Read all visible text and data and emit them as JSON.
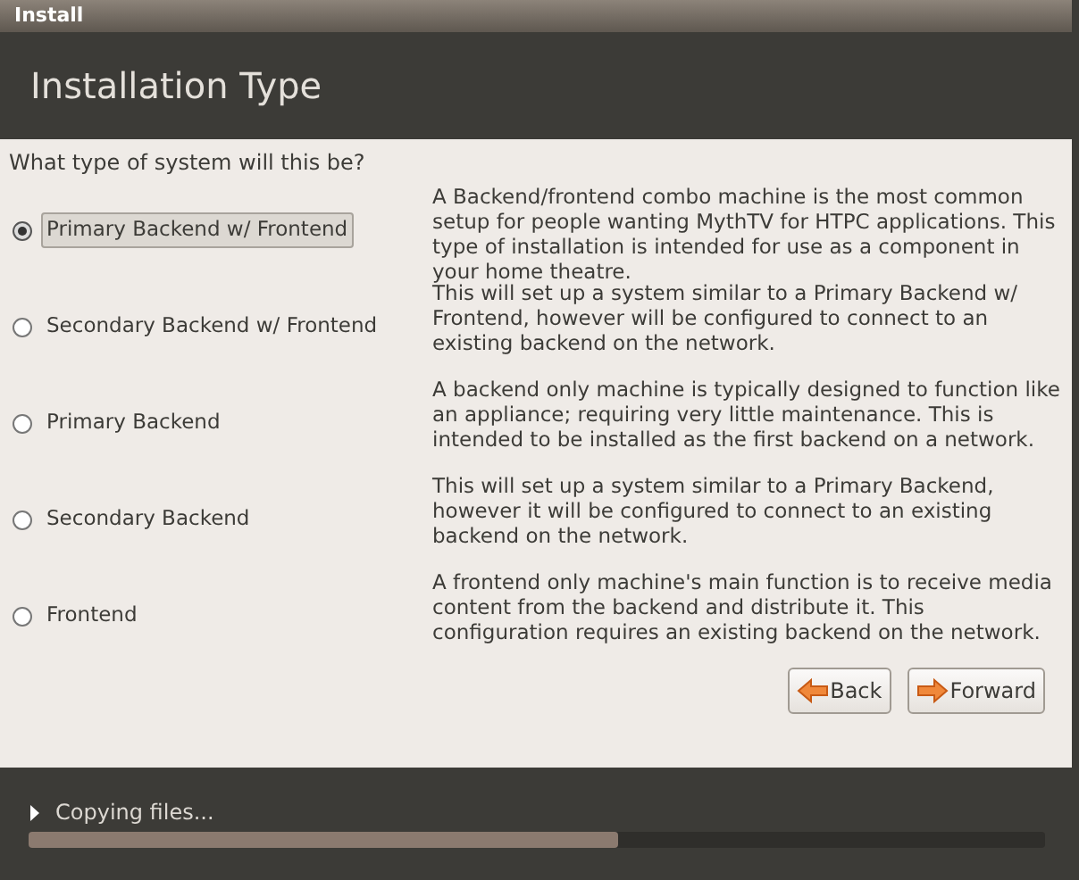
{
  "window": {
    "title": "Install"
  },
  "header": {
    "title": "Installation Type"
  },
  "question": "What type of system will this be?",
  "options": [
    {
      "label": "Primary Backend w/ Frontend",
      "selected": true,
      "description": "A Backend/frontend combo machine is the most common setup for people wanting MythTV for HTPC applications. This type of installation is intended for use as a component in your home theatre."
    },
    {
      "label": "Secondary Backend w/ Frontend",
      "selected": false,
      "description": "This will set up a system similar to a Primary Backend w/ Frontend, however will be configured to connect to an existing backend on the network."
    },
    {
      "label": "Primary Backend",
      "selected": false,
      "description": "A backend only machine is typically designed to function like an appliance; requiring very little maintenance.  This is intended to be installed as the first backend on a network."
    },
    {
      "label": "Secondary Backend",
      "selected": false,
      "description": "This will set up a system similar to a Primary Backend, however it will be configured to connect to an existing backend on the network."
    },
    {
      "label": "Frontend",
      "selected": false,
      "description": "A frontend only machine's main function is to receive media content from the backend and distribute it.  This configuration requires an existing backend on the network."
    }
  ],
  "buttons": [
    {
      "kind": "back",
      "label": "Back"
    },
    {
      "kind": "forward",
      "label": "Forward"
    }
  ],
  "progress": {
    "label": "Copying files...",
    "expanded": false,
    "level": 0.58
  }
}
